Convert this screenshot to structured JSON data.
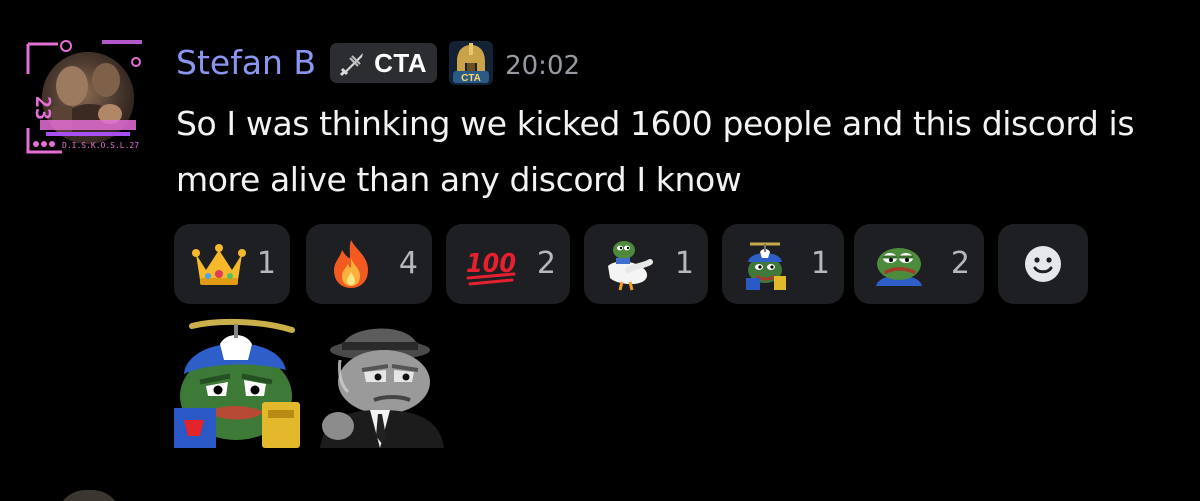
{
  "message": {
    "author": {
      "name": "Stefan B",
      "name_color": "#8c96f2",
      "avatar": "user-avatar-image",
      "avatar_frame_number": "23",
      "avatar_frame_text": "D.I.S.K.O.S.L.27"
    },
    "tag": {
      "icon": "crossed-swords-icon",
      "label": "CTA"
    },
    "guild_badge": {
      "icon": "spartan-helmet-icon",
      "label": "CTA"
    },
    "timestamp": "20:02",
    "content": "So I was thinking we kicked 1600 people and this discord is more alive than any discord I know"
  },
  "reactions": [
    {
      "emoji": "crown-emoji",
      "count": "1"
    },
    {
      "emoji": "fire-emoji",
      "count": "4"
    },
    {
      "emoji": "hundred-points-emoji",
      "count": "2",
      "glyph": "100"
    },
    {
      "emoji": "pepe-goose-emoji",
      "count": "1"
    },
    {
      "emoji": "pepe-propeller-cap-emoji",
      "count": "1"
    },
    {
      "emoji": "pepe-frog-emoji",
      "count": "2"
    }
  ],
  "add_reaction": {
    "icon": "smiley-icon"
  },
  "stickers": [
    {
      "name": "pepe-propeller-cap-sticker"
    },
    {
      "name": "pepe-detective-sticker"
    }
  ],
  "colors": {
    "background": "#000000",
    "chip_background": "#1e1f22",
    "tag_background": "#2b2d31",
    "text": "#f2f3f5",
    "muted": "#979aa3",
    "count": "#b5b8bf"
  }
}
